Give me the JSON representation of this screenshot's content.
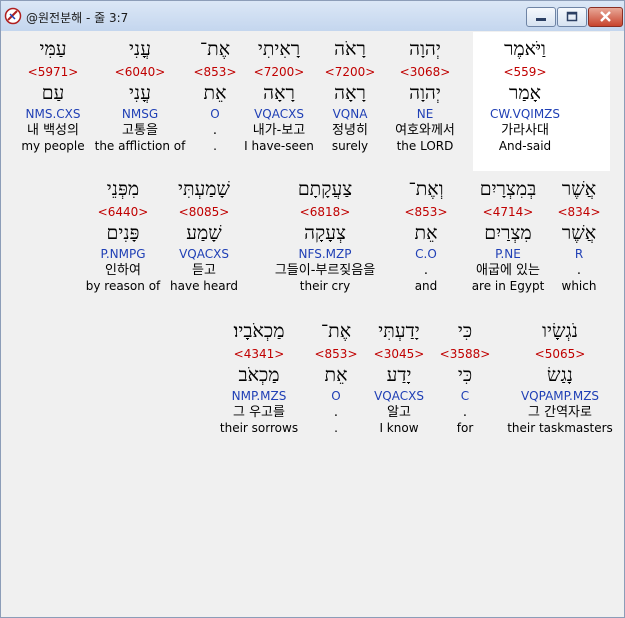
{
  "window": {
    "title": "@원전분해 - 줄 3:7"
  },
  "rows": [
    {
      "words": [
        {
          "heb": "עַמִּי",
          "strong": "<5971>",
          "lex": "עַם",
          "parse": "NMS.CXS",
          "kor": "내 백성의",
          "eng": "my people"
        },
        {
          "heb": "עֳנִי",
          "strong": "<6040>",
          "lex": "עֳנִי",
          "parse": "NMSG",
          "kor": "고통을",
          "eng": "the affliction of"
        },
        {
          "heb": "אֶת־",
          "strong": "<853>",
          "lex": "אֵת",
          "parse": "O",
          "kor": ".",
          "eng": "."
        },
        {
          "heb": "רָאִיתִי",
          "strong": "<7200>",
          "lex": "רָאָה",
          "parse": "VQACXS",
          "kor": "내가-보고",
          "eng": "I have-seen"
        },
        {
          "heb": "רָאֹה",
          "strong": "<7200>",
          "lex": "רָאָה",
          "parse": "VQNA",
          "kor": "정녕히",
          "eng": "surely"
        },
        {
          "heb": "יְהוָה",
          "strong": "<3068>",
          "lex": "יְהוָה",
          "parse": "NE",
          "kor": "여호와께서",
          "eng": "the LORD"
        },
        {
          "heb": "וַיֹּאמֶר",
          "strong": "<559>",
          "lex": "אָמַר",
          "parse": "CW.VQIMZS",
          "kor": "가라사대",
          "eng": "And-said"
        }
      ]
    },
    {
      "words": [
        {
          "heb": "מִפְּנֵי",
          "strong": "<6440>",
          "lex": "פָּנִים",
          "parse": "P.NMPG",
          "kor": "인하여",
          "eng": "by reason of"
        },
        {
          "heb": "שָׁמַעְתִּי",
          "strong": "<8085>",
          "lex": "שָׁמַע",
          "parse": "VQACXS",
          "kor": "듣고",
          "eng": "have heard"
        },
        {
          "heb": "צַעֲקָתָם",
          "strong": "<6818>",
          "lex": "צְעָקָה",
          "parse": "NFS.MZP",
          "kor": "그들이-부르짖음을",
          "eng": "their cry"
        },
        {
          "heb": "וְאֶת־",
          "strong": "<853>",
          "lex": "אֵת",
          "parse": "C.O",
          "kor": ".",
          "eng": "and"
        },
        {
          "heb": "בְּמִצְרָיִם",
          "strong": "<4714>",
          "lex": "מִצְרַיִם",
          "parse": "P.NE",
          "kor": "애굽에 있는",
          "eng": "are in Egypt"
        },
        {
          "heb": "אֲשֶׁר",
          "strong": "<834>",
          "lex": "אֲשֶׁר",
          "parse": "R",
          "kor": ".",
          "eng": "which"
        }
      ]
    },
    {
      "words": [
        {
          "heb": "מַכְאֹבָיו׃",
          "strong": "<4341>",
          "lex": "מַכְאֹב",
          "parse": "NMP.MZS",
          "kor": "그 우고를",
          "eng": "their sorrows"
        },
        {
          "heb": "אֶת־",
          "strong": "<853>",
          "lex": "אֵת",
          "parse": "O",
          "kor": ".",
          "eng": "."
        },
        {
          "heb": "יָדַעְתִּי",
          "strong": "<3045>",
          "lex": "יָדַע",
          "parse": "VQACXS",
          "kor": "알고",
          "eng": "I know"
        },
        {
          "heb": "כִּי",
          "strong": "<3588>",
          "lex": "כִּי",
          "parse": "C",
          "kor": ".",
          "eng": "for"
        },
        {
          "heb": "נֹגְשָׂיו",
          "strong": "<5065>",
          "lex": "נָגַשׂ",
          "parse": "VQPAMP.MZS",
          "kor": "그 간역자로",
          "eng": "their taskmasters"
        }
      ]
    }
  ]
}
